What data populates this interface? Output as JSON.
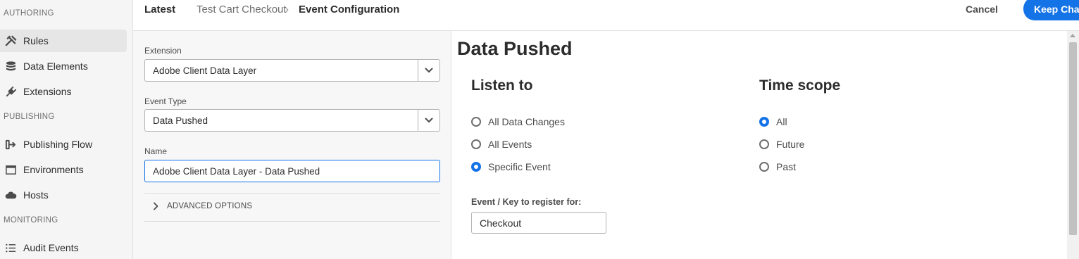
{
  "sidebar": {
    "sections": {
      "authoring": "AUTHORING",
      "publishing": "PUBLISHING",
      "monitoring": "MONITORING"
    },
    "items": [
      {
        "label": "Rules",
        "icon": "rules-icon",
        "active": true
      },
      {
        "label": "Data Elements",
        "icon": "database-icon"
      },
      {
        "label": "Extensions",
        "icon": "plug-icon"
      },
      {
        "label": "Publishing Flow",
        "icon": "publishing-flow-icon"
      },
      {
        "label": "Environments",
        "icon": "window-icon"
      },
      {
        "label": "Hosts",
        "icon": "cloud-icon"
      },
      {
        "label": "Audit Events",
        "icon": "list-icon"
      }
    ]
  },
  "header": {
    "latest": "Latest",
    "breadcrumb": [
      "Test Cart Checkout",
      "Event Configuration"
    ],
    "separator": "›",
    "cancel_label": "Cancel",
    "keep_label": "Keep Changes",
    "accent": "#1473e6"
  },
  "form": {
    "extension_label": "Extension",
    "extension_value": "Adobe Client Data Layer",
    "event_type_label": "Event Type",
    "event_type_value": "Data Pushed",
    "name_label": "Name",
    "name_value": "Adobe Client Data Layer - Data Pushed",
    "advanced_label": "ADVANCED OPTIONS"
  },
  "config": {
    "title": "Data Pushed",
    "listen_to": {
      "title": "Listen to",
      "options": [
        "All Data Changes",
        "All Events",
        "Specific Event"
      ],
      "selected": "Specific Event"
    },
    "time_scope": {
      "title": "Time scope",
      "options": [
        "All",
        "Future",
        "Past"
      ],
      "selected": "All"
    },
    "event_key_label": "Event / Key to register for:",
    "event_key_value": "Checkout"
  }
}
